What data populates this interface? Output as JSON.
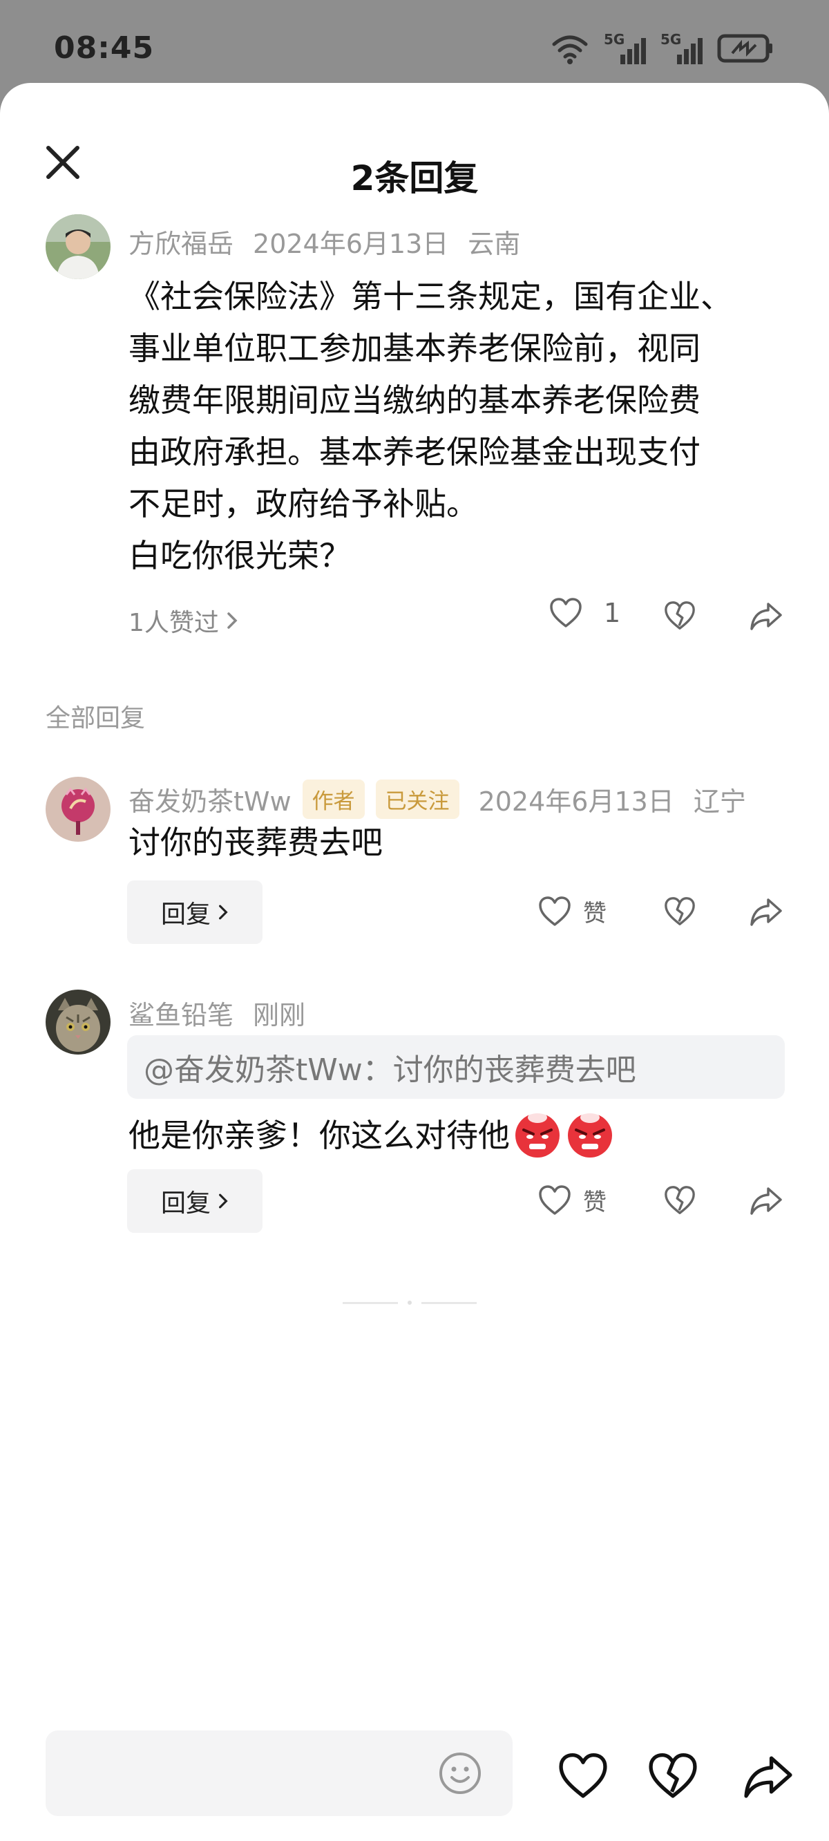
{
  "status_bar": {
    "time": "08:45",
    "network_labels": [
      "5G",
      "5G"
    ]
  },
  "header": {
    "title": "2条回复"
  },
  "main_comment": {
    "username": "方欣福岳",
    "date": "2024年6月13日",
    "location": "云南",
    "lines": [
      "《社会保险法》第十三条规定，国有企业、",
      "事业单位职工参加基本养老保险前，视同",
      "缴费年限期间应当缴纳的基本养老保险费",
      "由政府承担。基本养老保险基金出现支付",
      "不足时，政府给予补贴。",
      "白吃你很光荣？"
    ],
    "likers": "1人赞过",
    "like_count": "1"
  },
  "section_label": "全部回复",
  "replies": [
    {
      "username": "奋发奶茶tWw",
      "badges": [
        "作者",
        "已关注"
      ],
      "date": "2024年6月13日",
      "location": "辽宁",
      "text": "讨你的丧葬费去吧",
      "like_label": "赞",
      "reply_label": "回复"
    },
    {
      "username": "鲨鱼铅笔",
      "date": "刚刚",
      "quote": "@奋发奶茶tWw：讨你的丧葬费去吧",
      "text": "他是你亲爹！你这么对待他",
      "like_label": "赞",
      "reply_label": "回复"
    }
  ],
  "colors": {
    "background_dim": "#8e8e8e",
    "muted_text": "#999999",
    "badge_text": "#c99a3c",
    "badge_bg": "#fbf1dd",
    "emoji_red": "#e8333b"
  },
  "icons": [
    "close-icon",
    "heart-icon",
    "broken-heart-icon",
    "share-icon",
    "chevron-right-icon",
    "smiley-icon",
    "angry-emoji-icon"
  ]
}
